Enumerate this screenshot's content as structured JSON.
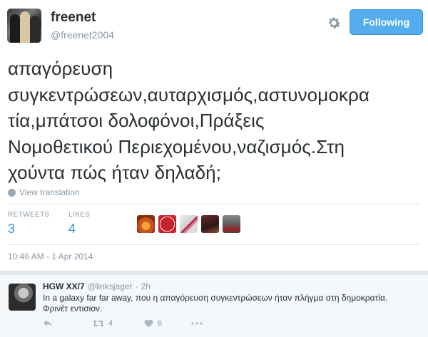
{
  "tweet": {
    "author_name": "freenet",
    "author_handle": "@freenet2004",
    "follow_button_label": "Following",
    "text_lines": [
      "απαγόρευση",
      "συγκεντρώσεων,αυταρχισμός,αστυνομοκρα",
      "τία,μπάτσοι δολοφόνοι,Πράξεις",
      "Νομοθετικού Περιεχομένου,ναζισμός.Στη",
      "χούντα πώς ήταν δηλαδή;"
    ],
    "view_translation": "View translation",
    "stats": {
      "retweets_label": "RETWEETS",
      "retweets_count": "3",
      "likes_label": "LIKES",
      "likes_count": "4"
    },
    "timestamp": "10:46 AM - 1 Apr 2014",
    "liker_colors": [
      "#c9551e",
      "#c4242b",
      "#d8d8d8",
      "#6b2a22",
      "#5c5c5c"
    ]
  },
  "reply": {
    "author_name": "HGW XX/7",
    "author_handle": "@linksjager",
    "separator": "·",
    "time": "2h",
    "text": "In a galaxy far far away, που η απαγόρευση συγκεντρώσεων ήταν πλήγμα στη δημοκρατία. Φρινέτ εντισιον.",
    "retweet_count": "4",
    "like_count": "6"
  },
  "colors": {
    "accent": "#55acee",
    "link": "#3b94d9",
    "muted": "#8899a6"
  },
  "icons": [
    "gear-icon",
    "globe-icon",
    "reply-icon",
    "retweet-icon",
    "heart-icon",
    "more-icon"
  ]
}
